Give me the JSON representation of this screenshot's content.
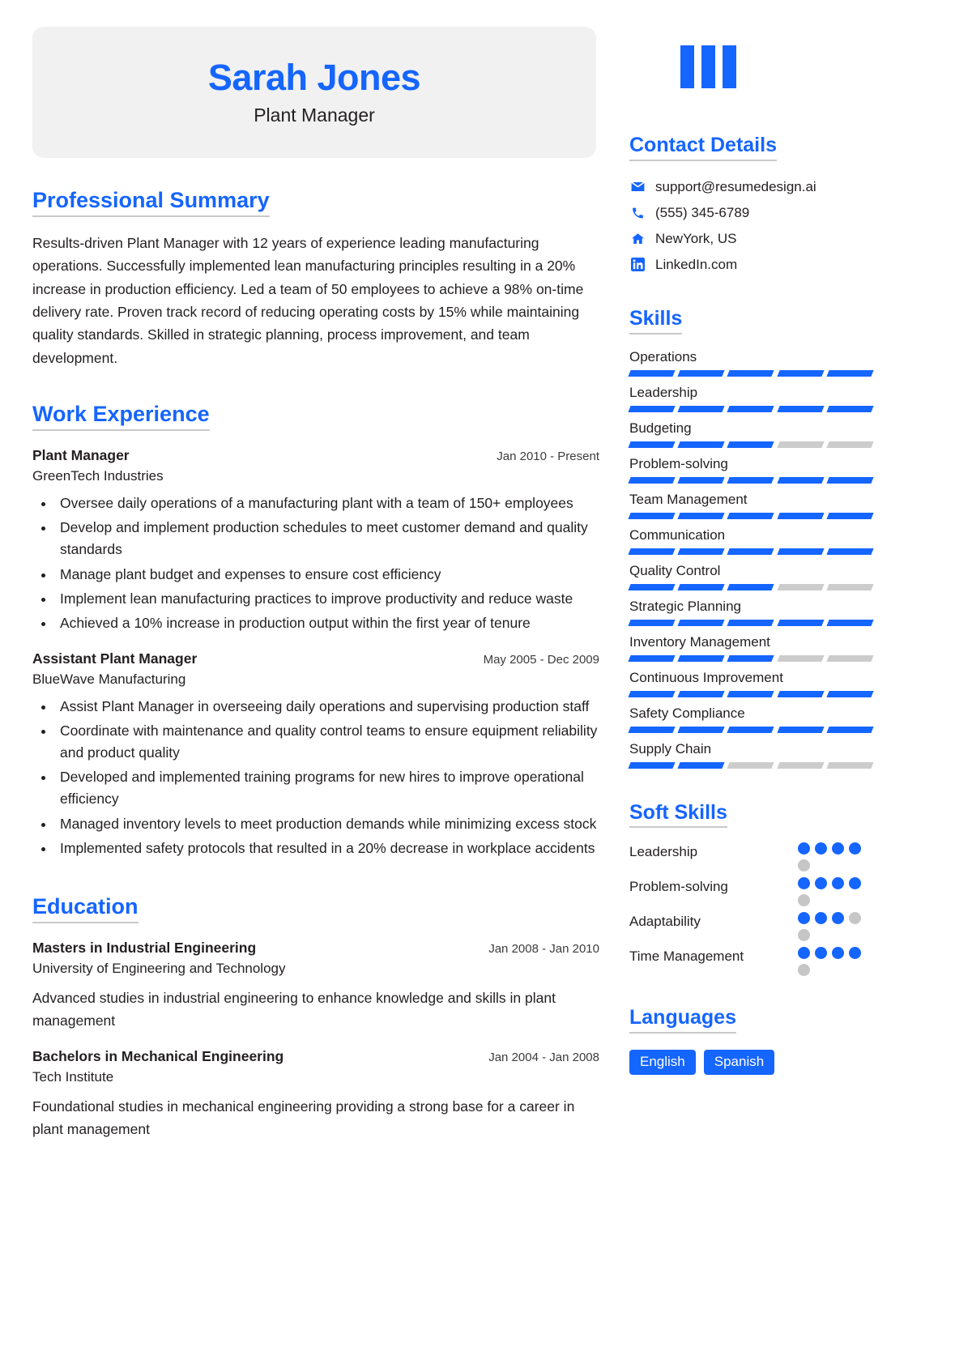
{
  "brand": {
    "accent": "#1565ff",
    "muted": "#cccccc",
    "header_bg": "#f1f1f1",
    "logo_icon": "three-bars-logo"
  },
  "header": {
    "name": "Sarah Jones",
    "role": "Plant Manager"
  },
  "summary": {
    "heading": "Professional Summary",
    "text": "Results-driven Plant Manager with 12 years of experience leading manufacturing operations. Successfully implemented lean manufacturing principles resulting in a 20% increase in production efficiency. Led a team of 50 employees to achieve a 98% on-time delivery rate. Proven track record of reducing operating costs by 15% while maintaining quality standards. Skilled in strategic planning, process improvement, and team development."
  },
  "work": {
    "heading": "Work Experience",
    "entries": [
      {
        "title": "Plant Manager",
        "date": "Jan 2010 - Present",
        "org": "GreenTech Industries",
        "bullets": [
          "Oversee daily operations of a manufacturing plant with a team of 150+ employees",
          "Develop and implement production schedules to meet customer demand and quality standards",
          "Manage plant budget and expenses to ensure cost efficiency",
          "Implement lean manufacturing practices to improve productivity and reduce waste",
          "Achieved a 10% increase in production output within the first year of tenure"
        ]
      },
      {
        "title": "Assistant Plant Manager",
        "date": "May 2005 - Dec 2009",
        "org": "BlueWave Manufacturing",
        "bullets": [
          "Assist Plant Manager in overseeing daily operations and supervising production staff",
          "Coordinate with maintenance and quality control teams to ensure equipment reliability and product quality",
          "Developed and implemented training programs for new hires to improve operational efficiency",
          "Managed inventory levels to meet production demands while minimizing excess stock",
          "Implemented safety protocols that resulted in a 20% decrease in workplace accidents"
        ]
      }
    ]
  },
  "education": {
    "heading": "Education",
    "entries": [
      {
        "title": "Masters in Industrial Engineering",
        "date": "Jan 2008 - Jan 2010",
        "org": "University of Engineering and Technology",
        "desc": "Advanced studies in industrial engineering to enhance knowledge and skills in plant management"
      },
      {
        "title": "Bachelors in Mechanical Engineering",
        "date": "Jan 2004 - Jan 2008",
        "org": "Tech Institute",
        "desc": "Foundational studies in mechanical engineering providing a strong base for a career in plant management"
      }
    ]
  },
  "contact": {
    "heading": "Contact Details",
    "items": [
      {
        "icon": "email-icon",
        "value": "support@resumedesign.ai"
      },
      {
        "icon": "phone-icon",
        "value": "(555) 345-6789"
      },
      {
        "icon": "home-icon",
        "value": "NewYork, US"
      },
      {
        "icon": "linkedin-icon",
        "value": "LinkedIn.com"
      }
    ]
  },
  "skills": {
    "heading": "Skills",
    "max_level": 5,
    "items": [
      {
        "name": "Operations",
        "level": 5
      },
      {
        "name": "Leadership",
        "level": 5
      },
      {
        "name": "Budgeting",
        "level": 3
      },
      {
        "name": "Problem-solving",
        "level": 5
      },
      {
        "name": "Team Management",
        "level": 5
      },
      {
        "name": "Communication",
        "level": 5
      },
      {
        "name": "Quality Control",
        "level": 3
      },
      {
        "name": "Strategic Planning",
        "level": 5
      },
      {
        "name": "Inventory Management",
        "level": 3
      },
      {
        "name": "Continuous Improvement",
        "level": 5
      },
      {
        "name": "Safety Compliance",
        "level": 5
      },
      {
        "name": "Supply Chain",
        "level": 2
      }
    ]
  },
  "soft_skills": {
    "heading": "Soft Skills",
    "max_level": 5,
    "items": [
      {
        "name": "Leadership",
        "level": 4
      },
      {
        "name": "Problem-solving",
        "level": 4
      },
      {
        "name": "Adaptability",
        "level": 3
      },
      {
        "name": "Time Management",
        "level": 4
      }
    ]
  },
  "languages": {
    "heading": "Languages",
    "items": [
      "English",
      "Spanish"
    ]
  }
}
